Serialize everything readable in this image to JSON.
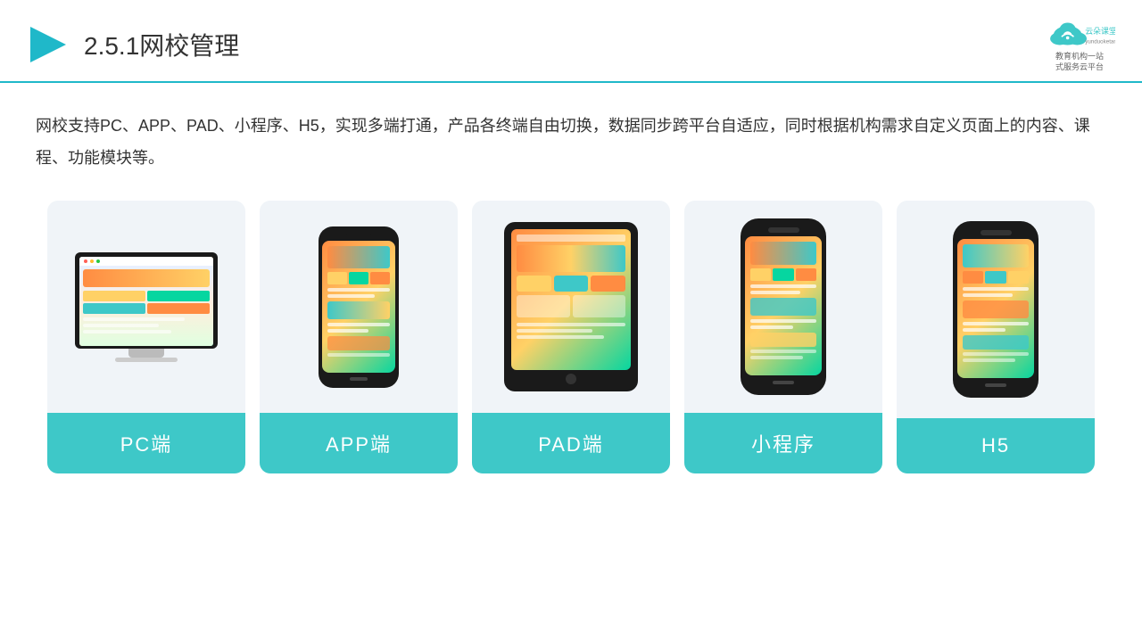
{
  "header": {
    "title": "2.5.1网校管理",
    "logo_name": "云朵课堂",
    "logo_sub": "yunduoketang.com",
    "logo_tagline": "教育机构一站\n式服务云平台"
  },
  "description": {
    "text": "网校支持PC、APP、PAD、小程序、H5，实现多端打通，产品各终端自由切换，数据同步跨平台自适应，同时根据机构需求自定义页面上的内容、课程、功能模块等。"
  },
  "cards": [
    {
      "id": "pc",
      "label": "PC端"
    },
    {
      "id": "app",
      "label": "APP端"
    },
    {
      "id": "pad",
      "label": "PAD端"
    },
    {
      "id": "miniprogram",
      "label": "小程序"
    },
    {
      "id": "h5",
      "label": "H5"
    }
  ],
  "brand": {
    "accent_color": "#3ec8c8",
    "border_color": "#1fb8c9"
  }
}
